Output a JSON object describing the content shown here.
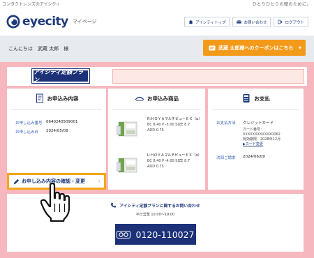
{
  "top": {
    "tagline_left": "コンタクトレンズのアイシティ",
    "tagline_right": "ひとりひとりの瞳のために。"
  },
  "header": {
    "logo": "eyecity",
    "page_label": "マイページ",
    "nav": [
      {
        "label": "アイシティトップ",
        "icon": "home-icon"
      },
      {
        "label": "お問い合わせ",
        "icon": "mail-icon"
      },
      {
        "label": "ログアウト",
        "icon": "logout-icon"
      }
    ]
  },
  "greeting": "こんにちは　武蔵 太郎　様",
  "coupon_button": "武蔵 太郎様へのクーポンはこちら",
  "plan": {
    "logo_text": "アイシティ定額プラン"
  },
  "application": {
    "title": "お申込み内容",
    "rows": [
      {
        "key": "お申し込み番号",
        "value": "0640240509001"
      },
      {
        "key": "お申し込み日",
        "value": "2024/05/09"
      }
    ],
    "confirm_button": "お申し込み内容の確認・変更"
  },
  "products": {
    "title": "お申込み商品",
    "items": [
      {
        "name": "R:ＨＯＹＡマルチビューＥＸ（α）",
        "spec": "BC 8.40 P -5.00 SIZE 8.7",
        "add": "ADD 0.75"
      },
      {
        "name": "L:ＨＯＹＡマルチビューＥＸ（α）",
        "spec": "BC 8.40 P -4.00 SIZE 8.7",
        "add": "ADD 0.75"
      }
    ]
  },
  "payment": {
    "title": "お支払",
    "method_key": "お支払方法",
    "method_value": "クレジットカード",
    "card_number_label": "カード番号：",
    "card_number": "XXXXXXXXXXXX0062",
    "expiry": "有効期限：2028年12月",
    "change_link": "▶カード変更",
    "next_key": "次回ご請求",
    "next_value": "2024/06/09"
  },
  "inquiry": {
    "title": "アイシティ定額プランに関するお問い合わせ",
    "hours": "平日営業 10:00〜19:00",
    "phone": "0120-110027"
  },
  "colors": {
    "navy": "#1c3178",
    "orange": "#f39a1a",
    "pink": "#f6b8be",
    "link_blue": "#2f5bb5"
  }
}
